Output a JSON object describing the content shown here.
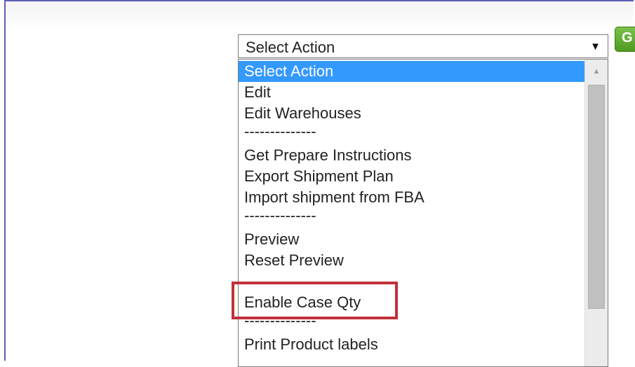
{
  "select": {
    "value": "Select Action",
    "arrow": "▼",
    "options": [
      {
        "label": "Select Action",
        "selected": true
      },
      {
        "label": "Edit"
      },
      {
        "label": "Edit Warehouses"
      },
      {
        "label": "--------------"
      },
      {
        "label": "Get Prepare Instructions"
      },
      {
        "label": "Export Shipment Plan"
      },
      {
        "label": "Import shipment from FBA"
      },
      {
        "label": "--------------"
      },
      {
        "label": "Preview"
      },
      {
        "label": "Reset Preview"
      },
      {
        "label": ""
      },
      {
        "label": "Enable Case Qty",
        "highlighted": true
      },
      {
        "label": "--------------"
      },
      {
        "label": "Print Product labels"
      }
    ]
  },
  "go_button": {
    "label": "G"
  },
  "scrollbar": {
    "up_arrow": "▲"
  },
  "colors": {
    "selected_bg": "#3399ff",
    "highlight_border": "#c0313a",
    "go_button": "#5aa52a"
  }
}
